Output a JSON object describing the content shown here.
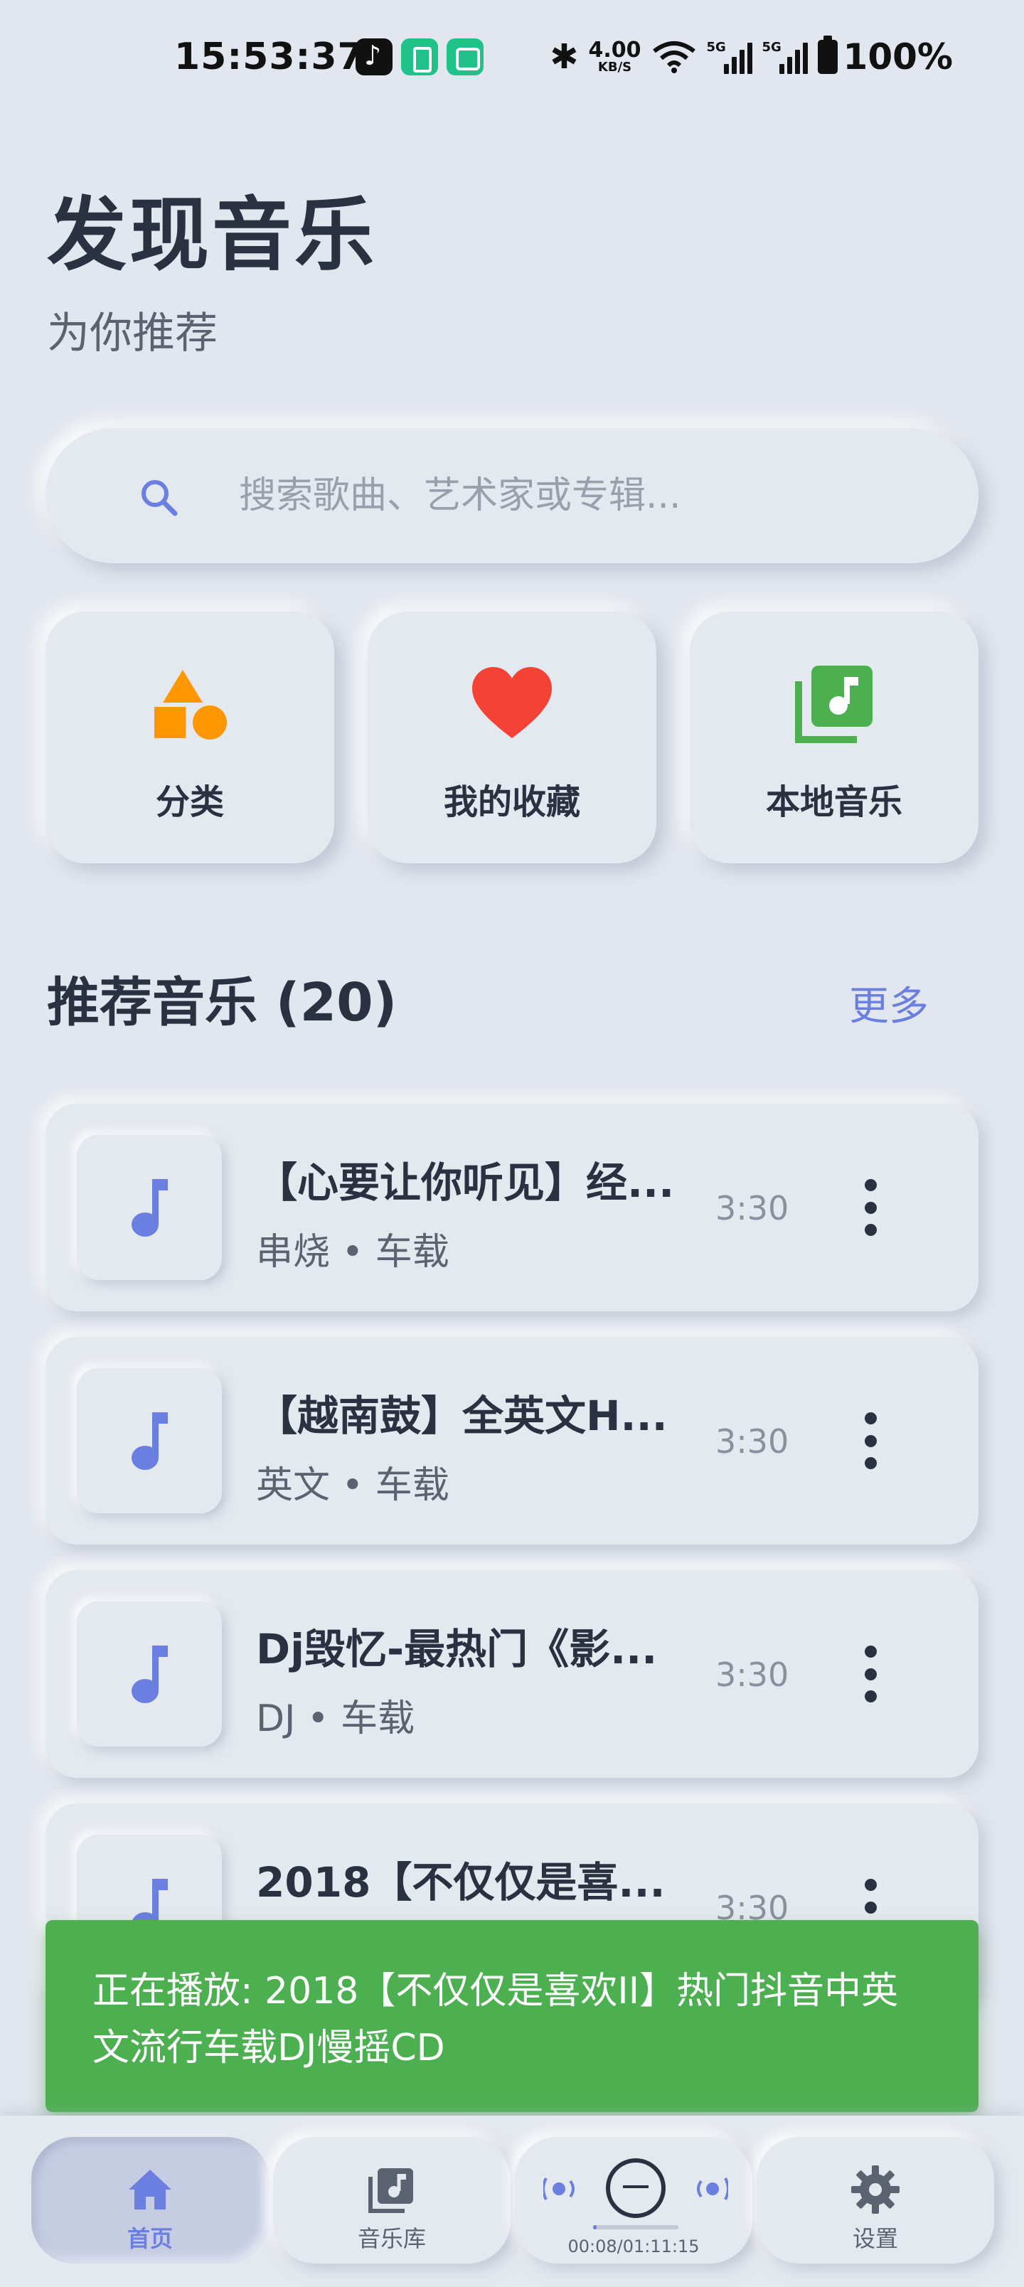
{
  "status_bar": {
    "time": "15:53:37",
    "net_speed_value": "4.00",
    "net_speed_unit": "KB/S",
    "signal1_label": "5G",
    "signal2_label": "5G",
    "battery": "100%",
    "icons": [
      "tiktok-icon",
      "battery-app-icon",
      "mi-home-icon",
      "bluetooth-icon",
      "wifi-icon",
      "signal-icon",
      "battery-icon"
    ]
  },
  "header": {
    "title": "发现音乐",
    "subtitle": "为你推荐"
  },
  "search": {
    "placeholder": "搜索歌曲、艺术家或专辑..."
  },
  "quick_actions": [
    {
      "label": "分类",
      "icon": "shapes-icon",
      "color": "#ff9800"
    },
    {
      "label": "我的收藏",
      "icon": "heart-icon",
      "color": "#f44336"
    },
    {
      "label": "本地音乐",
      "icon": "music-library-icon",
      "color": "#4caf50"
    }
  ],
  "recommended": {
    "title": "推荐音乐 (20)",
    "more": "更多",
    "songs": [
      {
        "title": "【心要让你听见】经...",
        "meta": "串烧 • 车载",
        "duration": "3:30"
      },
      {
        "title": "【越南鼓】全英文H...",
        "meta": "英文 • 车载",
        "duration": "3:30"
      },
      {
        "title": "Dj毁忆-最热门《影...",
        "meta": "DJ • 车载",
        "duration": "3:30"
      },
      {
        "title": "2018【不仅仅是喜...",
        "meta": "",
        "duration": "3:30"
      }
    ]
  },
  "toast": {
    "text": "正在播放: 2018【不仅仅是喜欢II】热门抖音中英文流行车载DJ慢摇CD"
  },
  "bottom_nav": {
    "home": "首页",
    "library": "音乐库",
    "settings": "设置",
    "player_time": "00:08/01:11:15",
    "progress": 0.0019
  },
  "colors": {
    "accent": "#6b7fe0",
    "background": "#e2e6ee",
    "toast": "#4caf50"
  }
}
